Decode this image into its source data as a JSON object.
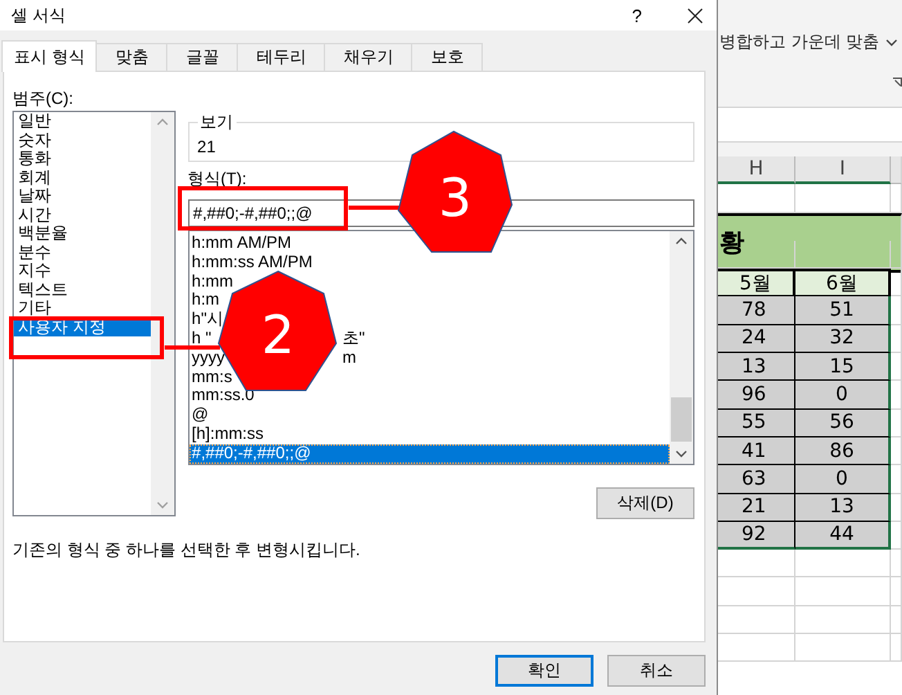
{
  "dialog": {
    "title": "셀 서식",
    "help": "?",
    "tabs": [
      {
        "label": "표시 형식",
        "selected": true
      },
      {
        "label": "맞춤",
        "selected": false
      },
      {
        "label": "글꼴",
        "selected": false
      },
      {
        "label": "테두리",
        "selected": false
      },
      {
        "label": "채우기",
        "selected": false
      },
      {
        "label": "보호",
        "selected": false
      }
    ],
    "category": {
      "label": "범주(C):",
      "items": [
        {
          "label": "일반",
          "selected": false
        },
        {
          "label": "숫자",
          "selected": false
        },
        {
          "label": "통화",
          "selected": false
        },
        {
          "label": "회계",
          "selected": false
        },
        {
          "label": "날짜",
          "selected": false
        },
        {
          "label": "시간",
          "selected": false
        },
        {
          "label": "백분율",
          "selected": false
        },
        {
          "label": "분수",
          "selected": false
        },
        {
          "label": "지수",
          "selected": false
        },
        {
          "label": "텍스트",
          "selected": false
        },
        {
          "label": "기타",
          "selected": false
        },
        {
          "label": "사용자 지정",
          "selected": true
        }
      ]
    },
    "preview": {
      "label": "보기",
      "value": "21"
    },
    "format": {
      "label": "형식(T):",
      "value": "#,##0;-#,##0;;@",
      "items": [
        {
          "text": "h:mm AM/PM",
          "selected": false
        },
        {
          "text": "h:mm:ss AM/PM",
          "selected": false
        },
        {
          "text": "h:mm",
          "selected": false
        },
        {
          "text": "h:m",
          "selected": false
        },
        {
          "text": "h\"시",
          "selected": false
        },
        {
          "text": "h \"",
          "tail": "초\"",
          "selected": false
        },
        {
          "text": "yyyy",
          "tail": "m",
          "selected": false
        },
        {
          "text": "mm:s",
          "selected": false
        },
        {
          "text": "mm:ss.0",
          "selected": false
        },
        {
          "text": "@",
          "selected": false
        },
        {
          "text": "[h]:mm:ss",
          "selected": false
        },
        {
          "text": "#,##0;-#,##0;;@",
          "selected": true
        }
      ]
    },
    "delete_button": "삭제(D)",
    "description": "기존의 형식 중 하나를 선택한 후 변형시킵니다.",
    "buttons": [
      {
        "label": "확인",
        "default": true
      },
      {
        "label": "취소",
        "default": false
      }
    ]
  },
  "callouts": [
    {
      "number": "3"
    },
    {
      "number": "2"
    }
  ],
  "sheet": {
    "ribbon_label": "병합하고 가운데 맞춤",
    "columns": [
      "H",
      "I"
    ],
    "title_fragment": "황",
    "header": [
      "5월",
      "6월"
    ],
    "rows": [
      [
        "78",
        "51"
      ],
      [
        "24",
        "32"
      ],
      [
        "13",
        "15"
      ],
      [
        "96",
        "0"
      ],
      [
        "55",
        "56"
      ],
      [
        "41",
        "86"
      ],
      [
        "63",
        "0"
      ],
      [
        "21",
        "13"
      ],
      [
        "92",
        "44"
      ]
    ]
  }
}
